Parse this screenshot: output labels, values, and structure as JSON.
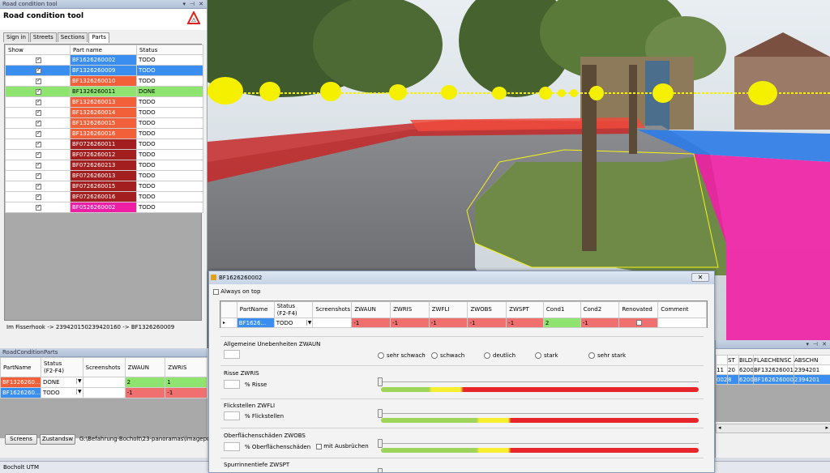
{
  "left_panel": {
    "window_title": "Road condition tool",
    "heading": "Road condition tool",
    "tabs": [
      "Sign in",
      "Streets",
      "Sections",
      "Parts"
    ],
    "active_tab": "Parts",
    "columns": [
      "Show",
      "Part name",
      "Status"
    ],
    "rows": [
      {
        "show": true,
        "name": "BF1626260002",
        "status": "TODO",
        "color": "#3a8ef0",
        "text": "#fff"
      },
      {
        "show": true,
        "name": "BF1326260009",
        "status": "TODO",
        "color": "#3a8ef0",
        "text": "#fff",
        "selected": true
      },
      {
        "show": true,
        "name": "BF1326260010",
        "status": "TODO",
        "color": "#f2603a",
        "text": "#fff"
      },
      {
        "show": true,
        "name": "BF1326260011",
        "status": "DONE",
        "color": "#8ee46f",
        "text": "#000",
        "row_color": "#8ee46f"
      },
      {
        "show": true,
        "name": "BF1326260013",
        "status": "TODO",
        "color": "#f2603a",
        "text": "#fff"
      },
      {
        "show": true,
        "name": "BF1326260014",
        "status": "TODO",
        "color": "#f2603a",
        "text": "#fff"
      },
      {
        "show": true,
        "name": "BF1326260015",
        "status": "TODO",
        "color": "#f2603a",
        "text": "#fff"
      },
      {
        "show": true,
        "name": "BF1326260016",
        "status": "TODO",
        "color": "#f2603a",
        "text": "#fff"
      },
      {
        "show": true,
        "name": "BF0726260011",
        "status": "TODO",
        "color": "#a31e1e",
        "text": "#fff"
      },
      {
        "show": true,
        "name": "BF0726260012",
        "status": "TODO",
        "color": "#a31e1e",
        "text": "#fff"
      },
      {
        "show": true,
        "name": "BF0726260213",
        "status": "TODO",
        "color": "#a31e1e",
        "text": "#fff"
      },
      {
        "show": true,
        "name": "BF0726260013",
        "status": "TODO",
        "color": "#a31e1e",
        "text": "#fff"
      },
      {
        "show": true,
        "name": "BF0726260015",
        "status": "TODO",
        "color": "#a31e1e",
        "text": "#fff"
      },
      {
        "show": true,
        "name": "BF0726260016",
        "status": "TODO",
        "color": "#a31e1e",
        "text": "#fff"
      },
      {
        "show": true,
        "name": "BF0526260002",
        "status": "TODO",
        "color": "#ef1fa5",
        "text": "#fff"
      }
    ],
    "route": "Im Fisserhook -> 239420150239420160 -> BF1326260009"
  },
  "parts_panel": {
    "title": "RoadConditionParts",
    "columns": [
      "PartName",
      "Status\n(F2-F4)",
      "Screenshots",
      "ZWAUN",
      "ZWRIS"
    ],
    "rows": [
      {
        "name": "BF1326260...",
        "status": "DONE",
        "zwaun": "2",
        "zwris": "1",
        "name_color": "#f2603a",
        "row_color": "#8ee46f"
      },
      {
        "name": "BF1626260...",
        "status": "TODO",
        "zwaun": "-1",
        "zwris": "-1",
        "name_color": "#3a8ef0",
        "row_color": "#f07070"
      }
    ],
    "btn_screens": "Screens",
    "btn_zustand": "Zustandsw",
    "path": "G:\\Befahrung-Bocholt\\23-panoramas\\imagepos"
  },
  "right_panel": {
    "columns": [
      "ST",
      "BILDI",
      "FLAECHENSC",
      "ABSCHN"
    ],
    "rows": [
      {
        "pre": "11",
        "st": "20",
        "bild": "6200",
        "fl": "BF1326260011",
        "ab": "2394201"
      },
      {
        "pre": "002",
        "st": "8",
        "bild": "6200",
        "fl": "BF1626260002",
        "ab": "2394201"
      }
    ]
  },
  "status_bar": "Bocholt UTM",
  "dialog": {
    "title": "BF1626260002",
    "always_on_top": "Always on top",
    "columns": [
      "PartName",
      "Status\n(F2-F4)",
      "Screenshots",
      "ZWAUN",
      "ZWRIS",
      "ZWFLI",
      "ZWOBS",
      "ZWSPT",
      "Cond1",
      "Cond2",
      "Renovated",
      "Comment"
    ],
    "row": {
      "part": "BF1626...",
      "status": "TODO",
      "zwaun": "-1",
      "zwris": "-1",
      "zwfli": "-1",
      "zwobs": "-1",
      "zwspt": "-1",
      "cond1": "2",
      "cond2": "-1"
    },
    "sec1": "Allgemeine Unebenheiten ZWAUN",
    "radios": [
      "sehr schwach",
      "schwach",
      "deutlich",
      "stark",
      "sehr stark"
    ],
    "sec2": "Risse ZWRIS",
    "sec2_unit": "% Risse",
    "sec3": "Flickstellen ZWFLI",
    "sec3_unit": "% Flickstellen",
    "sec4": "Oberflächenschäden ZWOBS",
    "sec4_unit": "% Oberflächenschäden",
    "sec4_check": "mit Ausbrüchen",
    "sec5": "Spurrinnentiefe ZWSPT"
  },
  "colors": {
    "blue": "#3a8ef0",
    "orange": "#f2603a",
    "green": "#8ee46f",
    "darkred": "#a31e1e",
    "magenta": "#ef1fa5",
    "red_row": "#f07070"
  }
}
